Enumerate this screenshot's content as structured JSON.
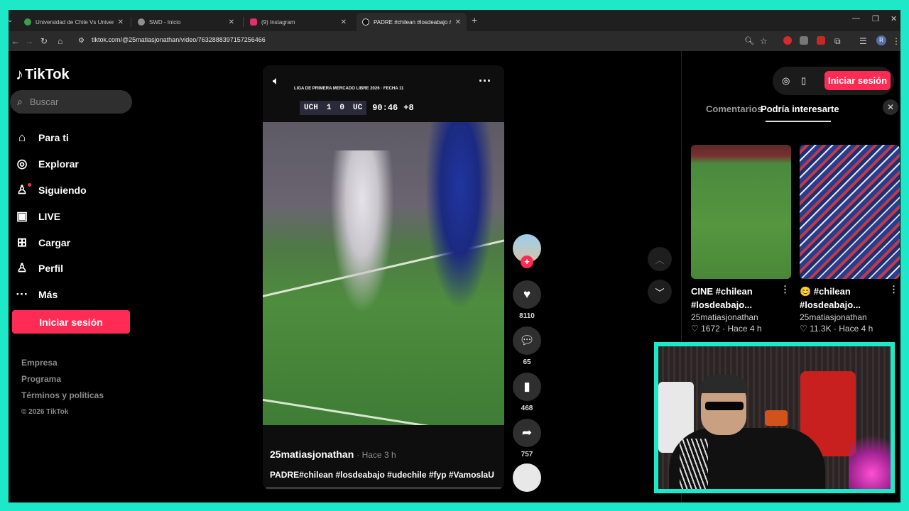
{
  "browser": {
    "tabs": [
      {
        "title": "Universidad de Chile Vs Universidad",
        "favicon_color": "#3aa04a"
      },
      {
        "title": "SWD - Inicio",
        "favicon_color": "#8f8f8f"
      },
      {
        "title": "(9) Instagram",
        "favicon_color": "#e1306c"
      },
      {
        "title": "PADRE #chilean #losdeabajo #ud",
        "favicon_color": "#ffffff"
      }
    ],
    "url": "tiktok.com/@25matiasjonathan/video/7632888397157256466",
    "new_tab": "+",
    "profile_letter": "R"
  },
  "sidebar": {
    "logo": "TikTok",
    "search_placeholder": "Buscar",
    "nav": [
      {
        "label": "Para ti",
        "icon": "home-icon"
      },
      {
        "label": "Explorar",
        "icon": "compass-icon"
      },
      {
        "label": "Siguiendo",
        "icon": "following-icon"
      },
      {
        "label": "LIVE",
        "icon": "live-icon"
      },
      {
        "label": "Cargar",
        "icon": "upload-icon"
      },
      {
        "label": "Perfil",
        "icon": "profile-icon"
      },
      {
        "label": "Más",
        "icon": "more-icon"
      }
    ],
    "login": "Iniciar sesión",
    "footer_links": [
      "Empresa",
      "Programa",
      "Términos y políticas"
    ],
    "copyright": "© 2026 TikTok"
  },
  "video": {
    "overlay_league": "LIGA DE PRIMERA MERCADO LIBRE 2026 · FECHA 11",
    "scoreboard": {
      "home": "UCH",
      "home_score": "1",
      "away_score": "0",
      "away": "UC",
      "clock": "90:46",
      "added": "+8"
    },
    "author": "25matiasjonathan",
    "time": "· Hace 3 h",
    "caption": "PADRE#chilean #losdeabajo #udechile #fyp #VamoslaU",
    "likes": "8110",
    "comments": "65",
    "saves": "468",
    "shares": "757"
  },
  "right_panel": {
    "login": "Iniciar sesión",
    "tab_comments": "Comentarios",
    "tab_suggested": "Podría interesarte",
    "cards": [
      {
        "title": "CINE #chilean #losdeabajo...",
        "author": "25matiasjonathan",
        "likes": "1672",
        "time": "Hace 4 h"
      },
      {
        "title": "😊 #chilean #losdeabajo...",
        "author": "25matiasjonathan",
        "likes": "11.3K",
        "time": "Hace 4 h"
      }
    ]
  }
}
